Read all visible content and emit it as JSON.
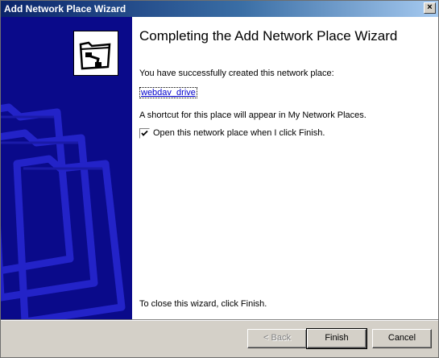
{
  "window": {
    "title": "Add Network Place Wizard",
    "close_glyph": "×"
  },
  "header": {
    "title": "Completing the Add Network Place Wizard"
  },
  "content": {
    "success_text": "You have successfully created this network place:",
    "place_name": "webdav_drive",
    "shortcut_text": "A shortcut for this place will appear in My Network Places.",
    "open_checkbox": {
      "label": "Open this network place when I click Finish.",
      "checked": true
    },
    "close_text": "To close this wizard, click Finish."
  },
  "buttons": {
    "back": "< Back",
    "finish": "Finish",
    "cancel": "Cancel"
  },
  "icons": {
    "close": "close-icon",
    "wizard": "network-folder-icon",
    "decor": "folder-watermark-icon",
    "check": "checkmark-icon"
  },
  "colors": {
    "title_start": "#0a246a",
    "title_end": "#a6caf0",
    "panel": "#0a0a8a",
    "link": "#0000cc"
  }
}
